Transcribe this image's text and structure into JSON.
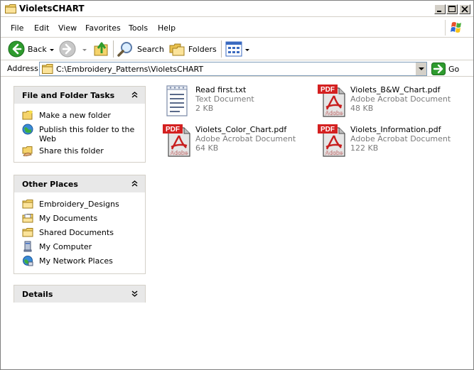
{
  "window": {
    "title": "VioletsCHART",
    "controls": [
      "minimize-icon",
      "maximize-icon",
      "close-icon"
    ]
  },
  "menu": {
    "items": [
      "File",
      "Edit",
      "View",
      "Favorites",
      "Tools",
      "Help"
    ]
  },
  "toolbar": {
    "back_label": "Back",
    "search_label": "Search",
    "folders_label": "Folders",
    "icons": [
      "back-arrow-icon",
      "forward-arrow-icon",
      "up-folder-icon",
      "search-icon",
      "folders-icon",
      "views-icon"
    ]
  },
  "address": {
    "label": "Address",
    "value": "C:\\Embroidery_Patterns\\VioletsCHART",
    "go_label": "Go"
  },
  "tasks_panel": {
    "title": "File and Folder Tasks",
    "items": [
      {
        "label": "Make a new folder",
        "icon": "new-folder-icon"
      },
      {
        "label": "Publish this folder to the Web",
        "icon": "publish-web-icon"
      },
      {
        "label": "Share this folder",
        "icon": "share-folder-icon"
      }
    ]
  },
  "places_panel": {
    "title": "Other Places",
    "items": [
      {
        "label": "Embroidery_Designs",
        "icon": "folder-icon"
      },
      {
        "label": "My Documents",
        "icon": "my-documents-icon"
      },
      {
        "label": "Shared Documents",
        "icon": "folder-icon"
      },
      {
        "label": "My Computer",
        "icon": "my-computer-icon"
      },
      {
        "label": "My Network Places",
        "icon": "network-places-icon"
      }
    ]
  },
  "details_panel": {
    "title": "Details"
  },
  "files": [
    {
      "name": "Read first.txt",
      "type": "Text Document",
      "size": "2 KB",
      "icon": "text-document-icon"
    },
    {
      "name": "Violets_B&W_Chart.pdf",
      "type": "Adobe Acrobat Document",
      "size": "48 KB",
      "icon": "pdf-icon"
    },
    {
      "name": "Violets_Color_Chart.pdf",
      "type": "Adobe Acrobat Document",
      "size": "64 KB",
      "icon": "pdf-icon"
    },
    {
      "name": "Violets_Information.pdf",
      "type": "Adobe Acrobat Document",
      "size": "122 KB",
      "icon": "pdf-icon"
    }
  ],
  "pdf_badge_text": "PDF",
  "pdf_brand_text": "Adobe",
  "colors": {
    "go_green": "#2e9b2e",
    "pdf_red": "#d42020",
    "panel_header": "#e8e8e8"
  }
}
